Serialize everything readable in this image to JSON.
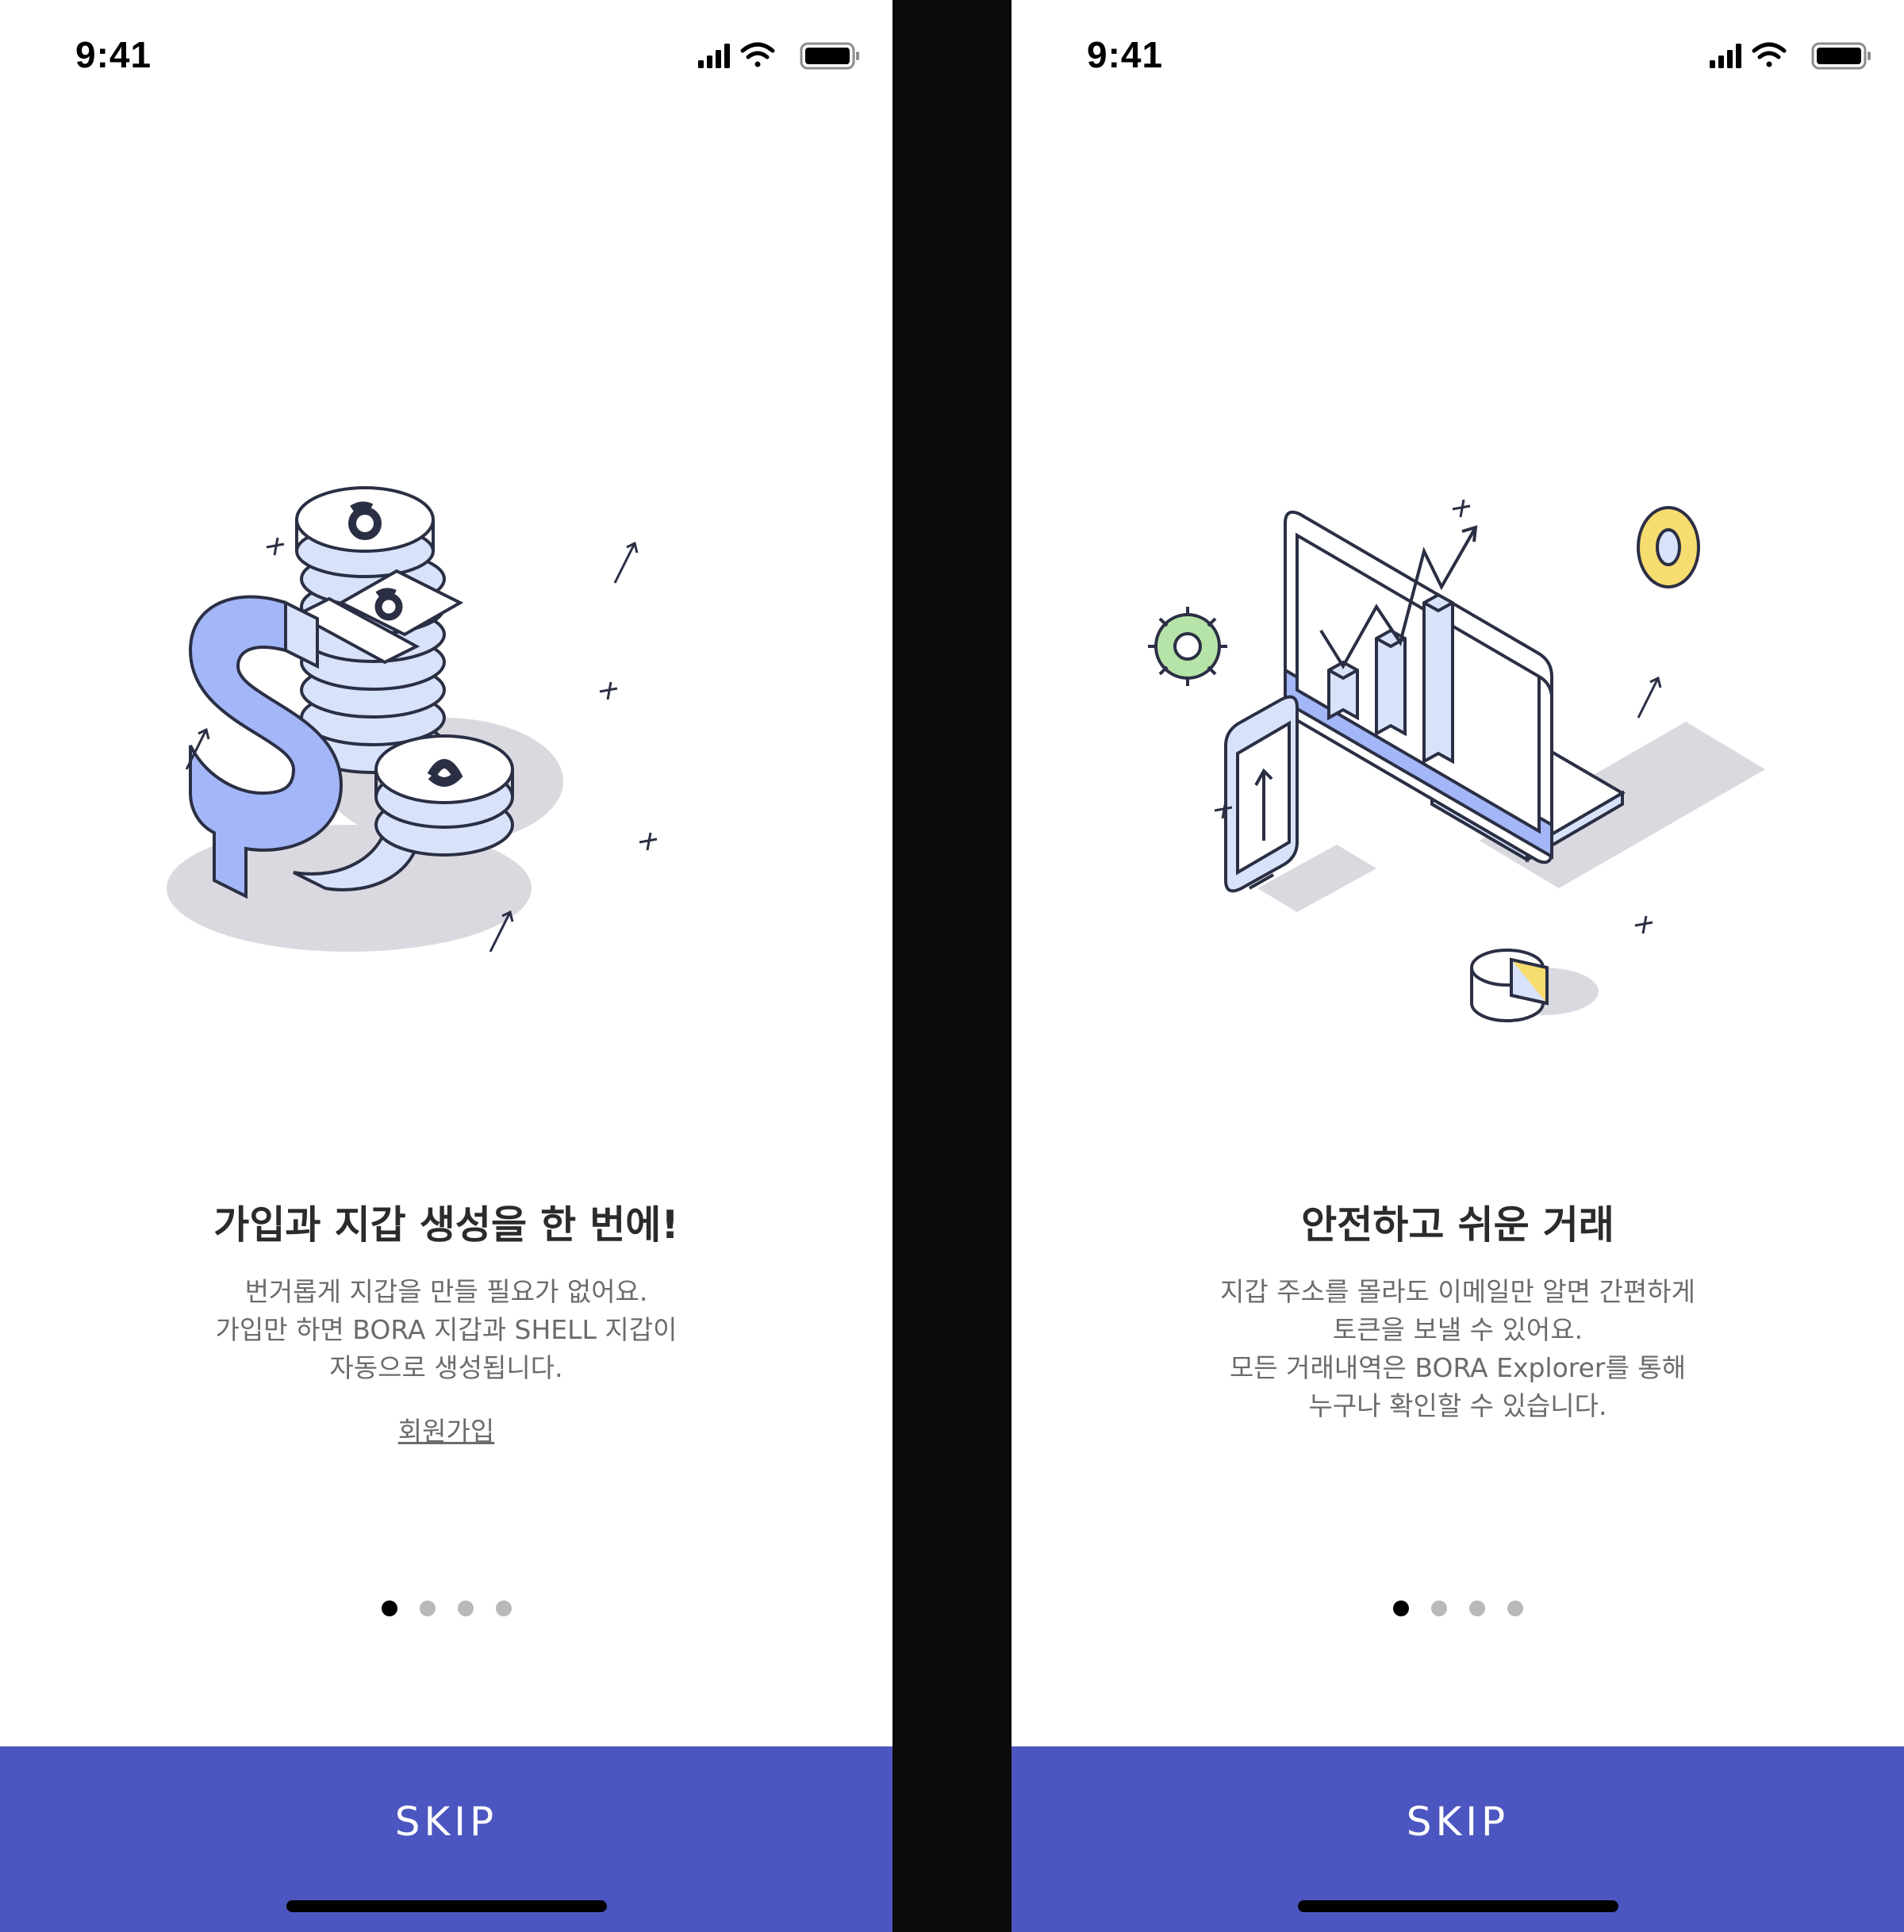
{
  "screens": [
    {
      "status": {
        "time": "9:41"
      },
      "illustration": "coins-stack-dollar-illustration",
      "title": "가입과 지갑 생성을 한 번에!",
      "body": [
        "번거롭게 지갑을 만들 필요가 없어요.",
        "가입만 하면 BORA 지갑과 SHELL 지갑이",
        "자동으로 생성됩니다."
      ],
      "link": "회원가입",
      "pager": {
        "total": 4,
        "active": 1
      },
      "skip": "SKIP"
    },
    {
      "status": {
        "time": "9:41"
      },
      "illustration": "monitor-chart-phone-illustration",
      "title": "안전하고 쉬운 거래",
      "body": [
        "지갑 주소를 몰라도 이메일만 알면 간편하게",
        "토큰을 보낼 수 있어요.",
        "모든 거래내역은 BORA Explorer를 통해",
        "누구나 확인할 수 있습니다."
      ],
      "pager": {
        "total": 4,
        "active": 1
      },
      "skip": "SKIP"
    }
  ],
  "colors": {
    "accent": "#4c56c0",
    "illustration_blue": "#a3b6f7",
    "illustration_light": "#d8e3fb",
    "illustration_yellow": "#f7dc6f",
    "illustration_green": "#b6e3a7",
    "outline": "#2b2f44"
  }
}
